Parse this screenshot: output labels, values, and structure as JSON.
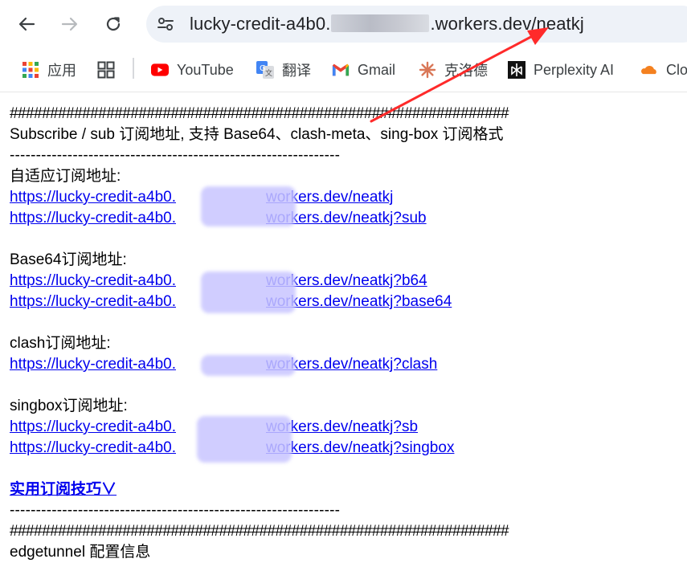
{
  "browser": {
    "url_prefix": "lucky-credit-a4b0.",
    "url_suffix": ".workers.dev/neatkj"
  },
  "bookmarks": [
    {
      "label": "应用",
      "icon": "apps-grid-icon"
    },
    {
      "label": "",
      "icon": "tab-groups-icon"
    },
    {
      "label": "YouTube",
      "icon": "youtube-icon"
    },
    {
      "label": "翻译",
      "icon": "google-translate-icon"
    },
    {
      "label": "Gmail",
      "icon": "gmail-icon"
    },
    {
      "label": "克洛德",
      "icon": "claude-icon"
    },
    {
      "label": "Perplexity AI",
      "icon": "perplexity-icon"
    },
    {
      "label": "Clo",
      "icon": "cloudflare-icon"
    }
  ],
  "content": {
    "hash_line": "##############################################################",
    "subscribe_title": "Subscribe / sub 订阅地址, 支持 Base64、clash-meta、sing-box 订阅格式",
    "dash_line": "---------------------------------------------------------------",
    "adaptive_label": "自适应订阅地址:",
    "base64_label": "Base64订阅地址:",
    "clash_label": "clash订阅地址:",
    "singbox_label": "singbox订阅地址:",
    "link_prefix": "https://lucky-credit-a4b0.",
    "links": {
      "adaptive_1": "workers.dev/neatkj",
      "adaptive_2": "workers.dev/neatkj?sub",
      "base64_1": "workers.dev/neatkj?b64",
      "base64_2": "workers.dev/neatkj?base64",
      "clash_1": "workers.dev/neatkj?clash",
      "singbox_1": "workers.dev/neatkj?sb",
      "singbox_2": "workers.dev/neatkj?singbox"
    },
    "tips_link": "实用订阅技巧∨",
    "config_title": "edgetunnel 配置信息"
  },
  "colors": {
    "link": "#0000ee",
    "annotation": "#ff2a2a",
    "redaction": "#c8c5ff"
  }
}
